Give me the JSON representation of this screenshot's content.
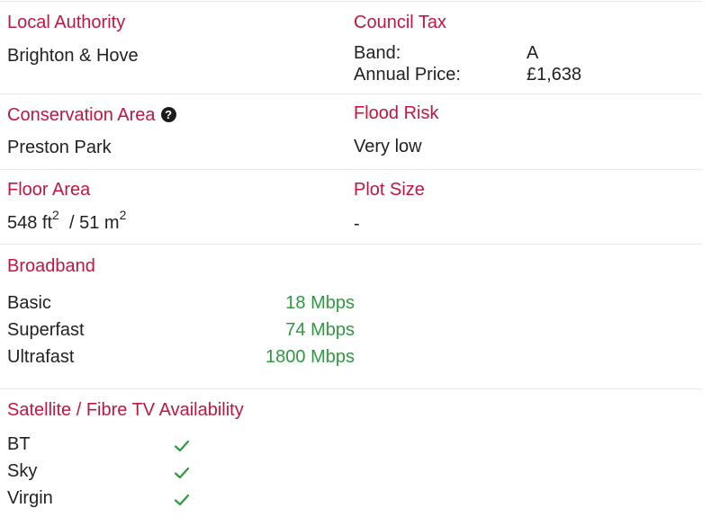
{
  "local_authority": {
    "label": "Local Authority",
    "value": "Brighton & Hove"
  },
  "council_tax": {
    "label": "Council Tax",
    "band_label": "Band:",
    "band_value": "A",
    "price_label": "Annual Price:",
    "price_value": "£1,638"
  },
  "conservation_area": {
    "label": "Conservation Area",
    "help_icon": "?",
    "value": "Preston Park"
  },
  "flood_risk": {
    "label": "Flood Risk",
    "value": "Very low"
  },
  "floor_area": {
    "label": "Floor Area",
    "ft_value": "548 ft",
    "ft_exp": "2",
    "separator": "/",
    "m_value": "51 m",
    "m_exp": "2"
  },
  "plot_size": {
    "label": "Plot Size",
    "value": "-"
  },
  "broadband": {
    "label": "Broadband",
    "rows": [
      {
        "name": "Basic",
        "speed": "18 Mbps"
      },
      {
        "name": "Superfast",
        "speed": "74 Mbps"
      },
      {
        "name": "Ultrafast",
        "speed": "1800 Mbps"
      }
    ]
  },
  "tv": {
    "label": "Satellite / Fibre TV Availability",
    "providers": [
      {
        "name": "BT",
        "available": true
      },
      {
        "name": "Sky",
        "available": true
      },
      {
        "name": "Virgin",
        "available": true
      }
    ],
    "check_icon": "check-icon"
  },
  "colors": {
    "label": "#c4143f",
    "text": "#222222",
    "available": "#2e9a3e",
    "divider": "#e8e8e8"
  }
}
